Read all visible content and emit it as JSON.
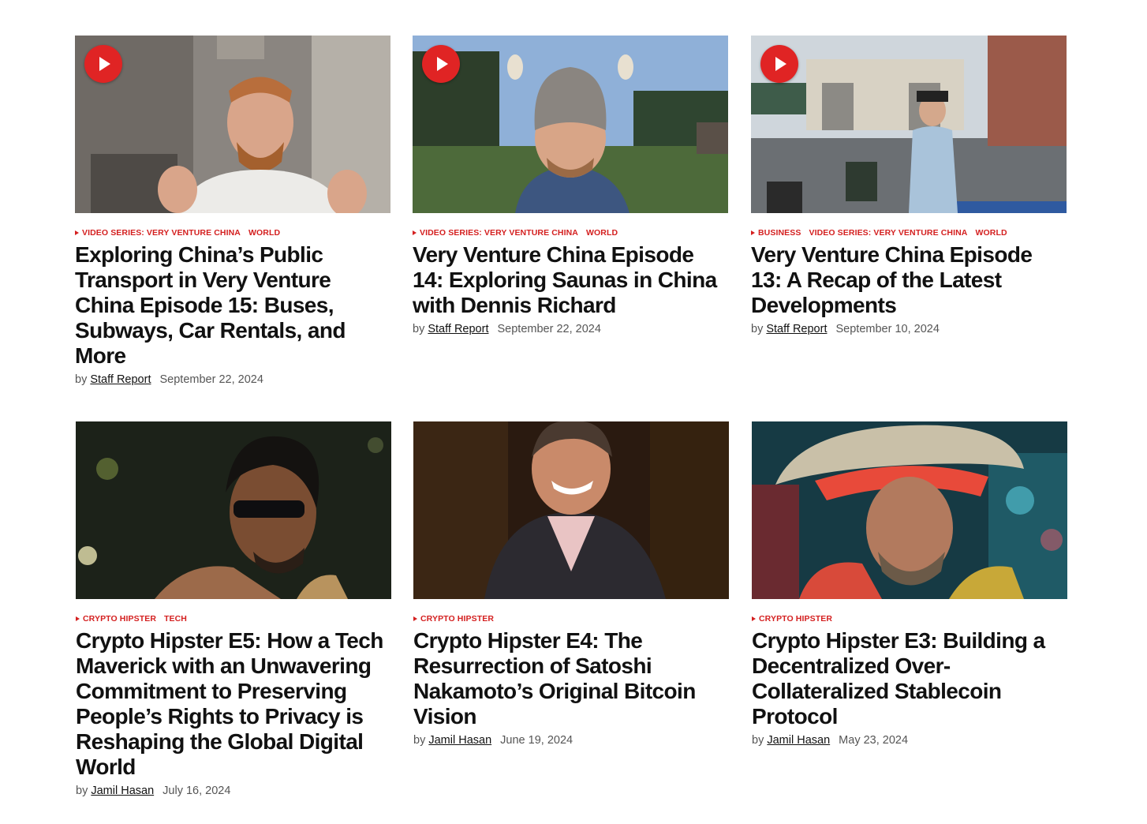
{
  "articles": [
    {
      "has_video": true,
      "image": "man in white shirt gesturing in room",
      "categories": [
        "VIDEO SERIES: VERY VENTURE CHINA",
        "WORLD"
      ],
      "title": "Exploring China’s Public Transport in Very Venture China Episode 15: Buses, Subways, Car Rentals, and More",
      "by": "by",
      "author": "Staff Report",
      "date": "September 22, 2024"
    },
    {
      "has_video": true,
      "image": "man in knit viking hat outdoors",
      "categories": [
        "VIDEO SERIES: VERY VENTURE CHINA",
        "WORLD"
      ],
      "title": "Very Venture China Episode 14: Exploring Saunas in China with Dennis Richard",
      "by": "by",
      "author": "Staff Report",
      "date": "September 22, 2024"
    },
    {
      "has_video": true,
      "image": "man walking on street in China",
      "categories": [
        "BUSINESS",
        "VIDEO SERIES: VERY VENTURE CHINA",
        "WORLD"
      ],
      "title": "Very Venture China Episode 13: A Recap of the Latest Developments",
      "by": "by",
      "author": "Staff Report",
      "date": "September 10, 2024"
    },
    {
      "has_video": false,
      "image": "man with sunglasses portrait",
      "categories": [
        "CRYPTO HIPSTER",
        "TECH"
      ],
      "title": "Crypto Hipster E5: How a Tech Maverick with an Unwavering Commitment to Preserving People’s Rights to Privacy is Reshaping the Global Digital World",
      "by": "by",
      "author": "Jamil Hasan",
      "date": "July 16, 2024"
    },
    {
      "has_video": false,
      "image": "smiling man in suit",
      "categories": [
        "CRYPTO HIPSTER"
      ],
      "title": "Crypto Hipster E4: The Resurrection of Satoshi Nakamoto’s Original Bitcoin Vision",
      "by": "by",
      "author": "Jamil Hasan",
      "date": "June 19, 2024"
    },
    {
      "has_video": false,
      "image": "3D rendered cowboy in neon city",
      "categories": [
        "CRYPTO HIPSTER"
      ],
      "title": "Crypto Hipster E3: Building a Decentralized Over-Collateralized Stablecoin Protocol",
      "by": "by",
      "author": "Jamil Hasan",
      "date": "May 23, 2024"
    }
  ],
  "colors": {
    "accent": "#d42020",
    "play": "#e02424"
  }
}
